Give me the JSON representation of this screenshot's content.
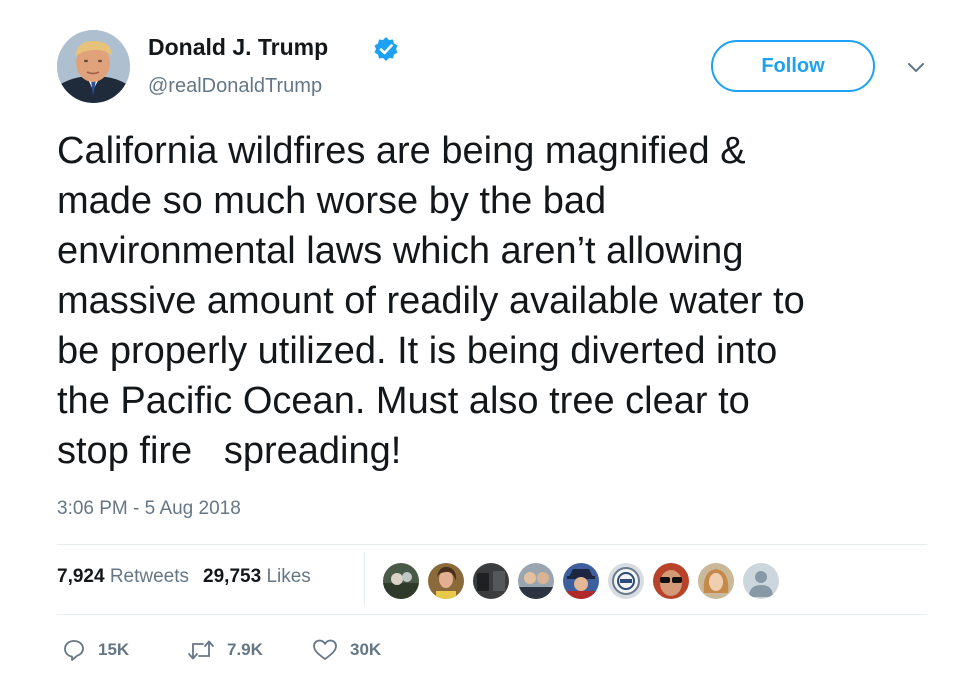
{
  "author": {
    "display_name": "Donald J. Trump",
    "handle": "@realDonaldTrump",
    "verified": true
  },
  "follow_button_label": "Follow",
  "tweet_text": "California wildfires are being magnified &\nmade so much worse by the bad\nenvironmental laws which aren’t allowing\nmassive amount of readily available water to\nbe properly utilized. It is being diverted into\nthe Pacific Ocean. Must also tree clear to\nstop fire   spreading!",
  "timestamp": "3:06 PM - 5 Aug 2018",
  "stats": {
    "retweets_count": "7,924",
    "retweets_label": "Retweets",
    "likes_count": "29,753",
    "likes_label": "Likes"
  },
  "likers": [
    {
      "icon": "liker-avatar-1"
    },
    {
      "icon": "liker-avatar-2"
    },
    {
      "icon": "liker-avatar-3"
    },
    {
      "icon": "liker-avatar-4"
    },
    {
      "icon": "liker-avatar-5"
    },
    {
      "icon": "liker-avatar-6"
    },
    {
      "icon": "liker-avatar-7"
    },
    {
      "icon": "liker-avatar-8"
    },
    {
      "icon": "liker-avatar-default"
    }
  ],
  "actions": {
    "reply_count": "15K",
    "retweet_count": "7.9K",
    "like_count": "30K"
  },
  "colors": {
    "accent": "#1da1f2",
    "secondary_text": "#657786",
    "primary_text": "#14171a",
    "divider": "#e6ecf0"
  }
}
